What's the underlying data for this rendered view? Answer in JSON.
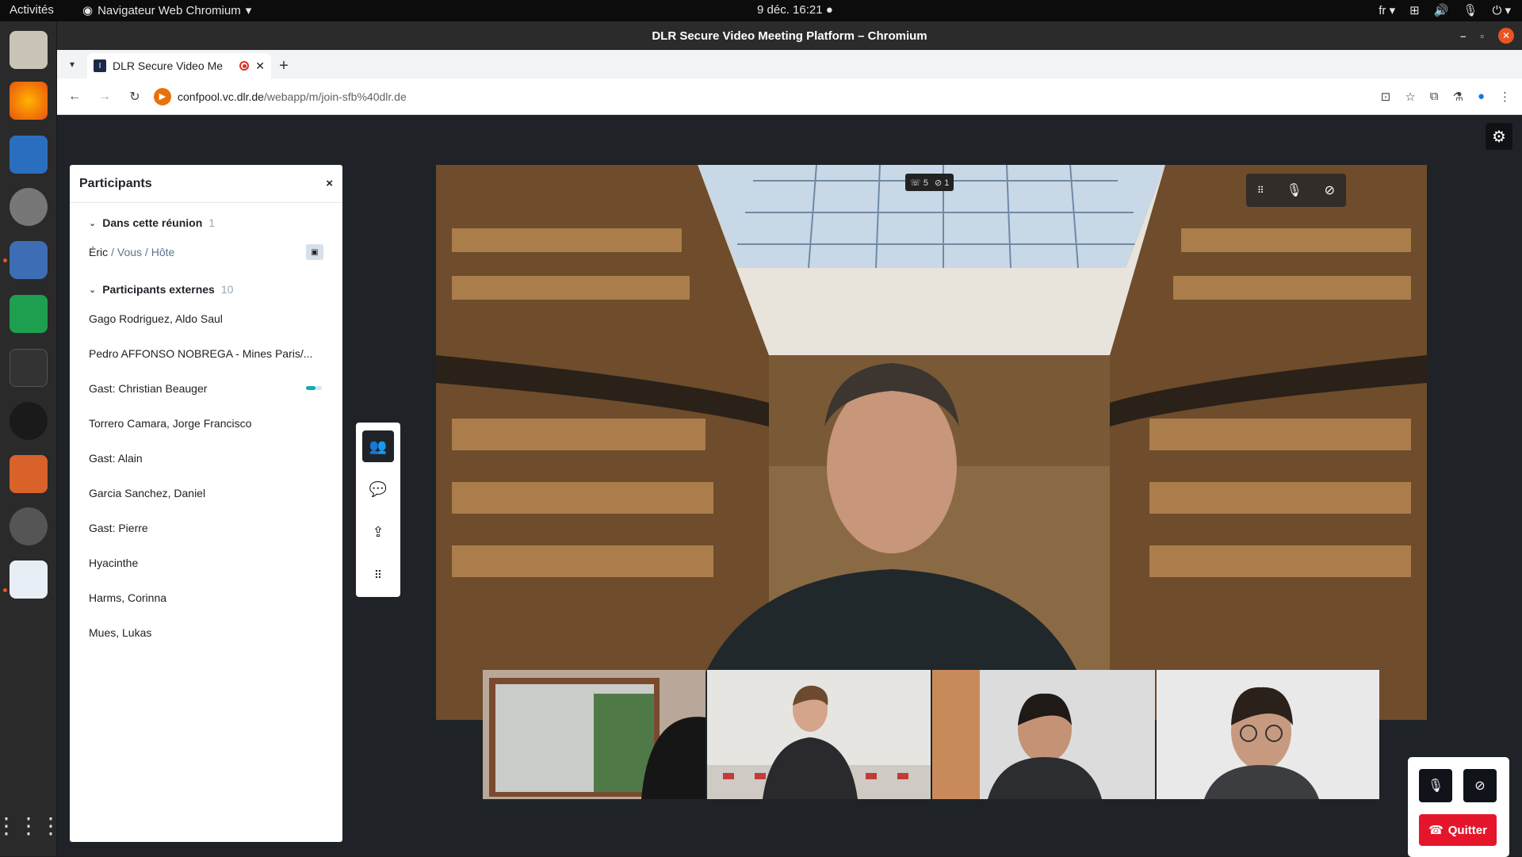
{
  "system": {
    "activities": "Activités",
    "app_name": "Navigateur Web Chromium",
    "clock": "9 déc.  16:21",
    "lang": "fr"
  },
  "window": {
    "title": "DLR Secure Video Meeting Platform – Chromium"
  },
  "browser": {
    "tab_title": "DLR Secure Video Me",
    "url_host": "confpool.vc.dlr.de",
    "url_path": "/webapp/m/join-sfb%40dlr.de"
  },
  "panel": {
    "title": "Participants",
    "close": "×",
    "group_in_meeting": {
      "label": "Dans cette réunion",
      "count": "1",
      "items": [
        {
          "name": "Éric",
          "role": "/ Vous / Hôte",
          "camera": "off"
        }
      ]
    },
    "group_external": {
      "label": "Participants externes",
      "count": "10",
      "items": [
        {
          "name": "Gago Rodriguez, Aldo Saul"
        },
        {
          "name": "Pedro AFFONSO NOBREGA - Mines Paris/..."
        },
        {
          "name": "Gast: Christian Beauger",
          "audio_level": 0.6
        },
        {
          "name": "Torrero Camara, Jorge Francisco"
        },
        {
          "name": "Gast: Alain"
        },
        {
          "name": "Garcia Sanchez, Daniel"
        },
        {
          "name": "Gast: Pierre"
        },
        {
          "name": "Hyacinthe"
        },
        {
          "name": "Harms, Corinna"
        },
        {
          "name": "Mues, Lukas"
        }
      ]
    }
  },
  "stage": {
    "stats_audio": "5",
    "stats_video": "1"
  },
  "controls": {
    "quit_label": "Quitter"
  },
  "colors": {
    "accent_teal": "#19a8b8",
    "quit_red": "#e5162b",
    "ubuntu_orange": "#e95420"
  }
}
